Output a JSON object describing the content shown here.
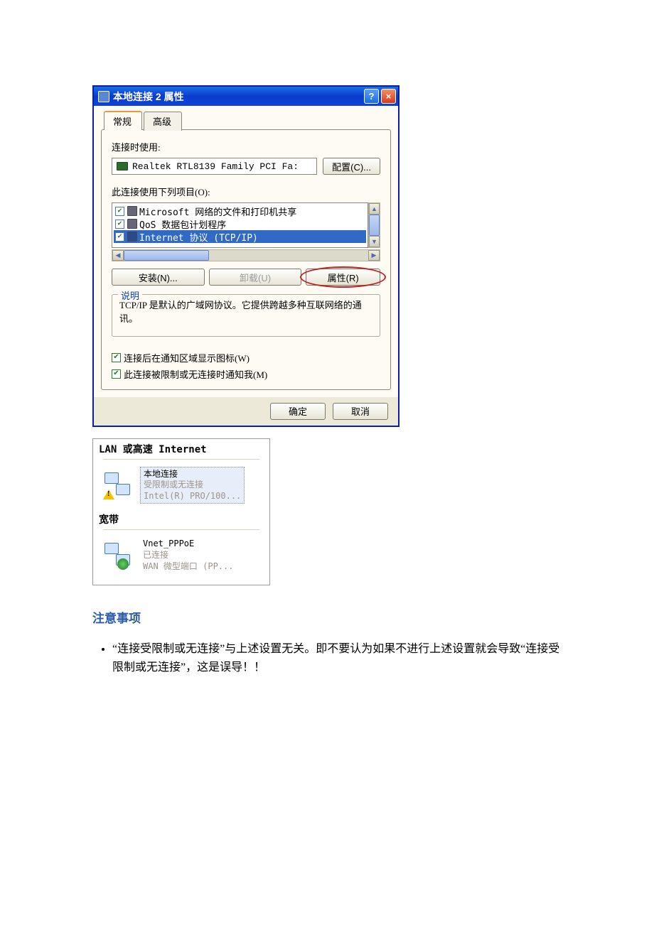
{
  "dialog": {
    "title": "本地连接 2 属性",
    "tabs": {
      "general": "常规",
      "advanced": "高级"
    },
    "connect_using_label": "连接时使用:",
    "adapter_name": "Realtek RTL8139 Family PCI Fa:",
    "configure_btn": "配置(C)...",
    "uses_items_label": "此连接使用下列项目(O):",
    "items": [
      {
        "label": "Microsoft 网络的文件和打印机共享",
        "checked": true,
        "selected": false
      },
      {
        "label": "QoS 数据包计划程序",
        "checked": true,
        "selected": false
      },
      {
        "label": "Internet 协议 (TCP/IP)",
        "checked": true,
        "selected": true
      }
    ],
    "install_btn": "安装(N)...",
    "uninstall_btn": "卸载(U)",
    "properties_btn": "属性(R)",
    "desc_legend": "说明",
    "desc_text": "TCP/IP 是默认的广域网协议。它提供跨越多种互联网络的通讯。",
    "show_icon_label": "连接后在通知区域显示图标(W)",
    "notify_limited_label": "此连接被限制或无连接时通知我(M)",
    "ok_btn": "确定",
    "cancel_btn": "取消"
  },
  "explorer": {
    "lan_heading": "LAN 或高速 Internet",
    "broadband_heading": "宽带",
    "lan_item": {
      "name": "本地连接",
      "status": "受限制或无连接",
      "device": "Intel(R) PRO/100..."
    },
    "bb_item": {
      "name": "Vnet_PPPoE",
      "status": "已连接",
      "device": "WAN 微型端口 (PP..."
    }
  },
  "doc": {
    "heading": "注意事项",
    "bullet": "“连接受限制或无连接”与上述设置无关。即不要认为如果不进行上述设置就会导致“连接受限制或无连接”，这是误导！！"
  }
}
